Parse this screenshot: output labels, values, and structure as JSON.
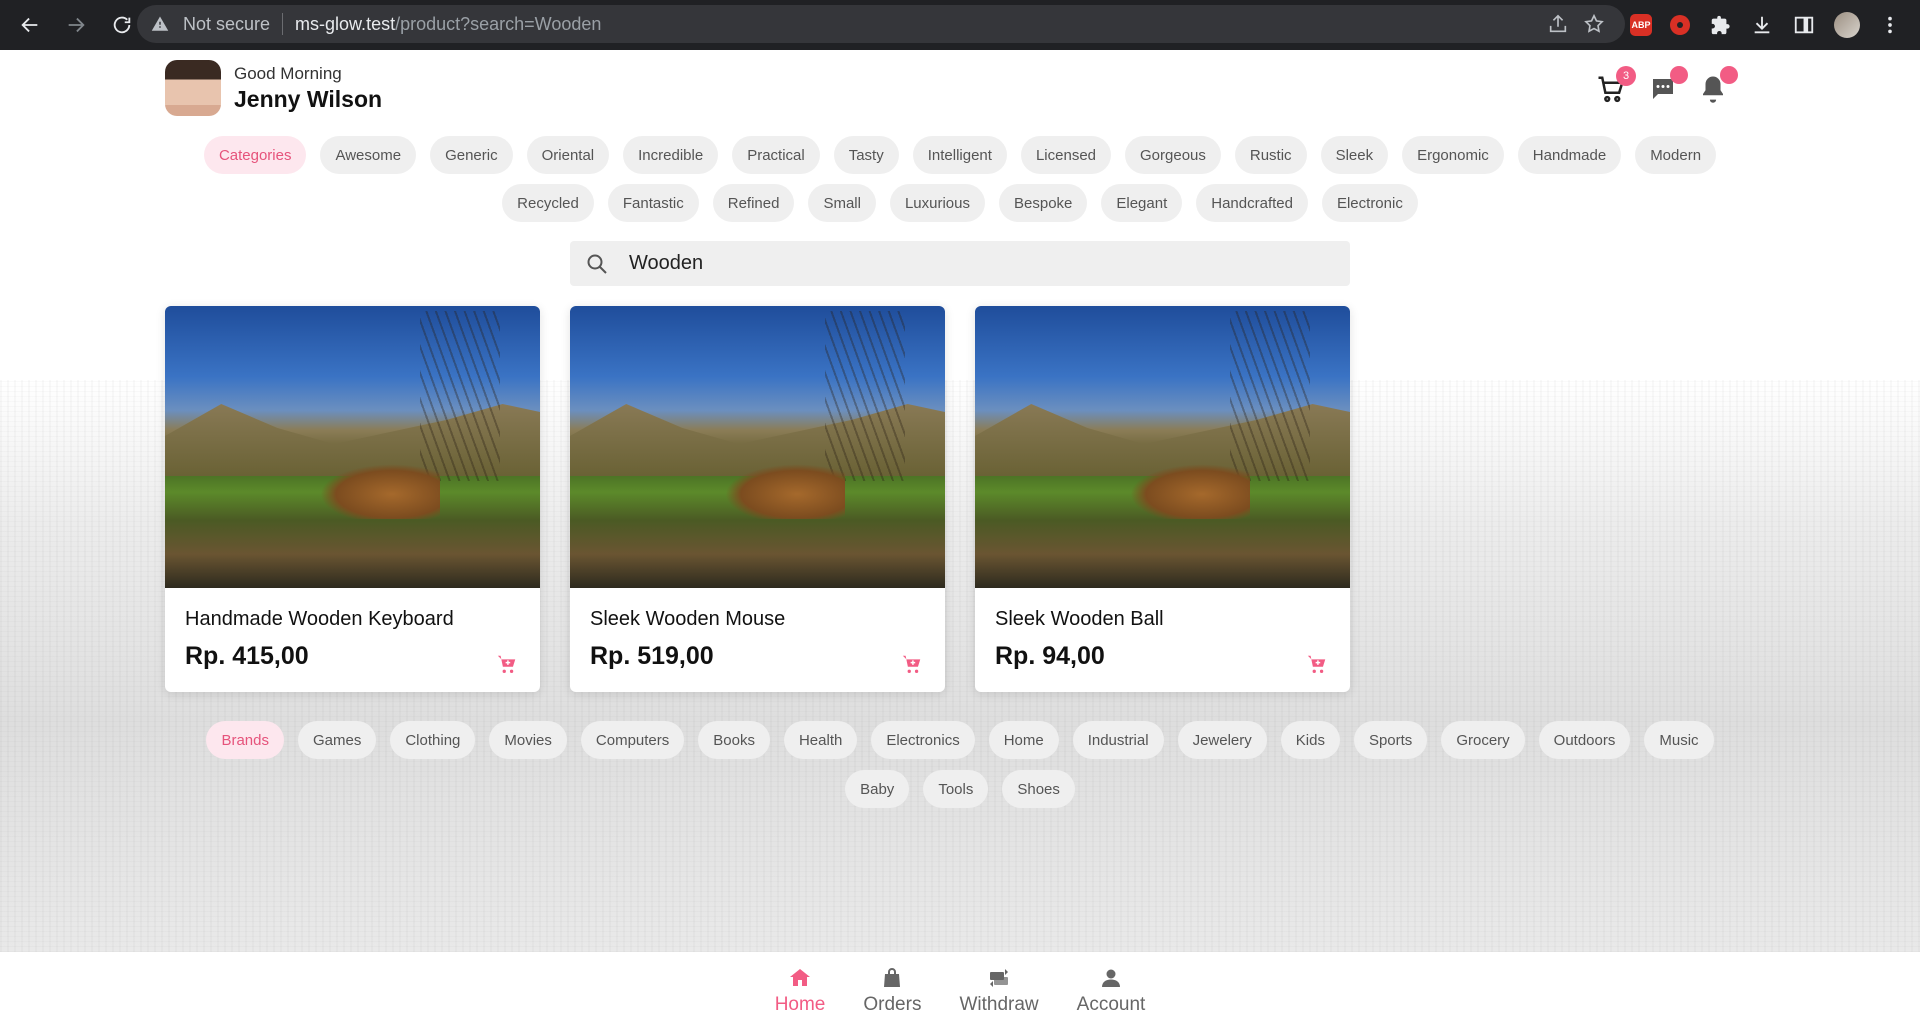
{
  "browser": {
    "security_label": "Not secure",
    "url_host": "ms-glow.test",
    "url_path": "/product?search=Wooden",
    "extension_abp": "ABP"
  },
  "header": {
    "greeting": "Good Morning",
    "username": "Jenny Wilson",
    "cart_badge": "3",
    "message_badge": "",
    "notification_badge": ""
  },
  "categories": {
    "active_label": "Categories",
    "row1": [
      "Awesome",
      "Generic",
      "Oriental",
      "Incredible",
      "Practical",
      "Tasty",
      "Intelligent",
      "Licensed",
      "Gorgeous",
      "Rustic",
      "Sleek",
      "Ergonomic",
      "Handmade",
      "Modern"
    ],
    "row2": [
      "Recycled",
      "Fantastic",
      "Refined",
      "Small",
      "Luxurious",
      "Bespoke",
      "Elegant",
      "Handcrafted",
      "Electronic"
    ]
  },
  "search": {
    "value": "Wooden",
    "icon": "search-icon"
  },
  "products": [
    {
      "title": "Handmade Wooden Keyboard",
      "price": "Rp. 415,00"
    },
    {
      "title": "Sleek Wooden Mouse",
      "price": "Rp. 519,00"
    },
    {
      "title": "Sleek Wooden Ball",
      "price": "Rp. 94,00"
    }
  ],
  "brands": {
    "active_label": "Brands",
    "row1": [
      "Games",
      "Clothing",
      "Movies",
      "Computers",
      "Books",
      "Health",
      "Electronics",
      "Home",
      "Industrial",
      "Jewelery",
      "Kids",
      "Sports",
      "Grocery",
      "Outdoors",
      "Music"
    ],
    "row2": [
      "Baby",
      "Tools",
      "Shoes"
    ]
  },
  "bottom_nav": [
    {
      "label": "Home",
      "icon": "home-icon",
      "active": true
    },
    {
      "label": "Orders",
      "icon": "bag-icon",
      "active": false
    },
    {
      "label": "Withdraw",
      "icon": "transfer-icon",
      "active": false
    },
    {
      "label": "Account",
      "icon": "user-icon",
      "active": false
    }
  ],
  "colors": {
    "accent": "#f25c84",
    "chip_bg": "#efefef",
    "chip_active_bg": "#fde7ee"
  }
}
